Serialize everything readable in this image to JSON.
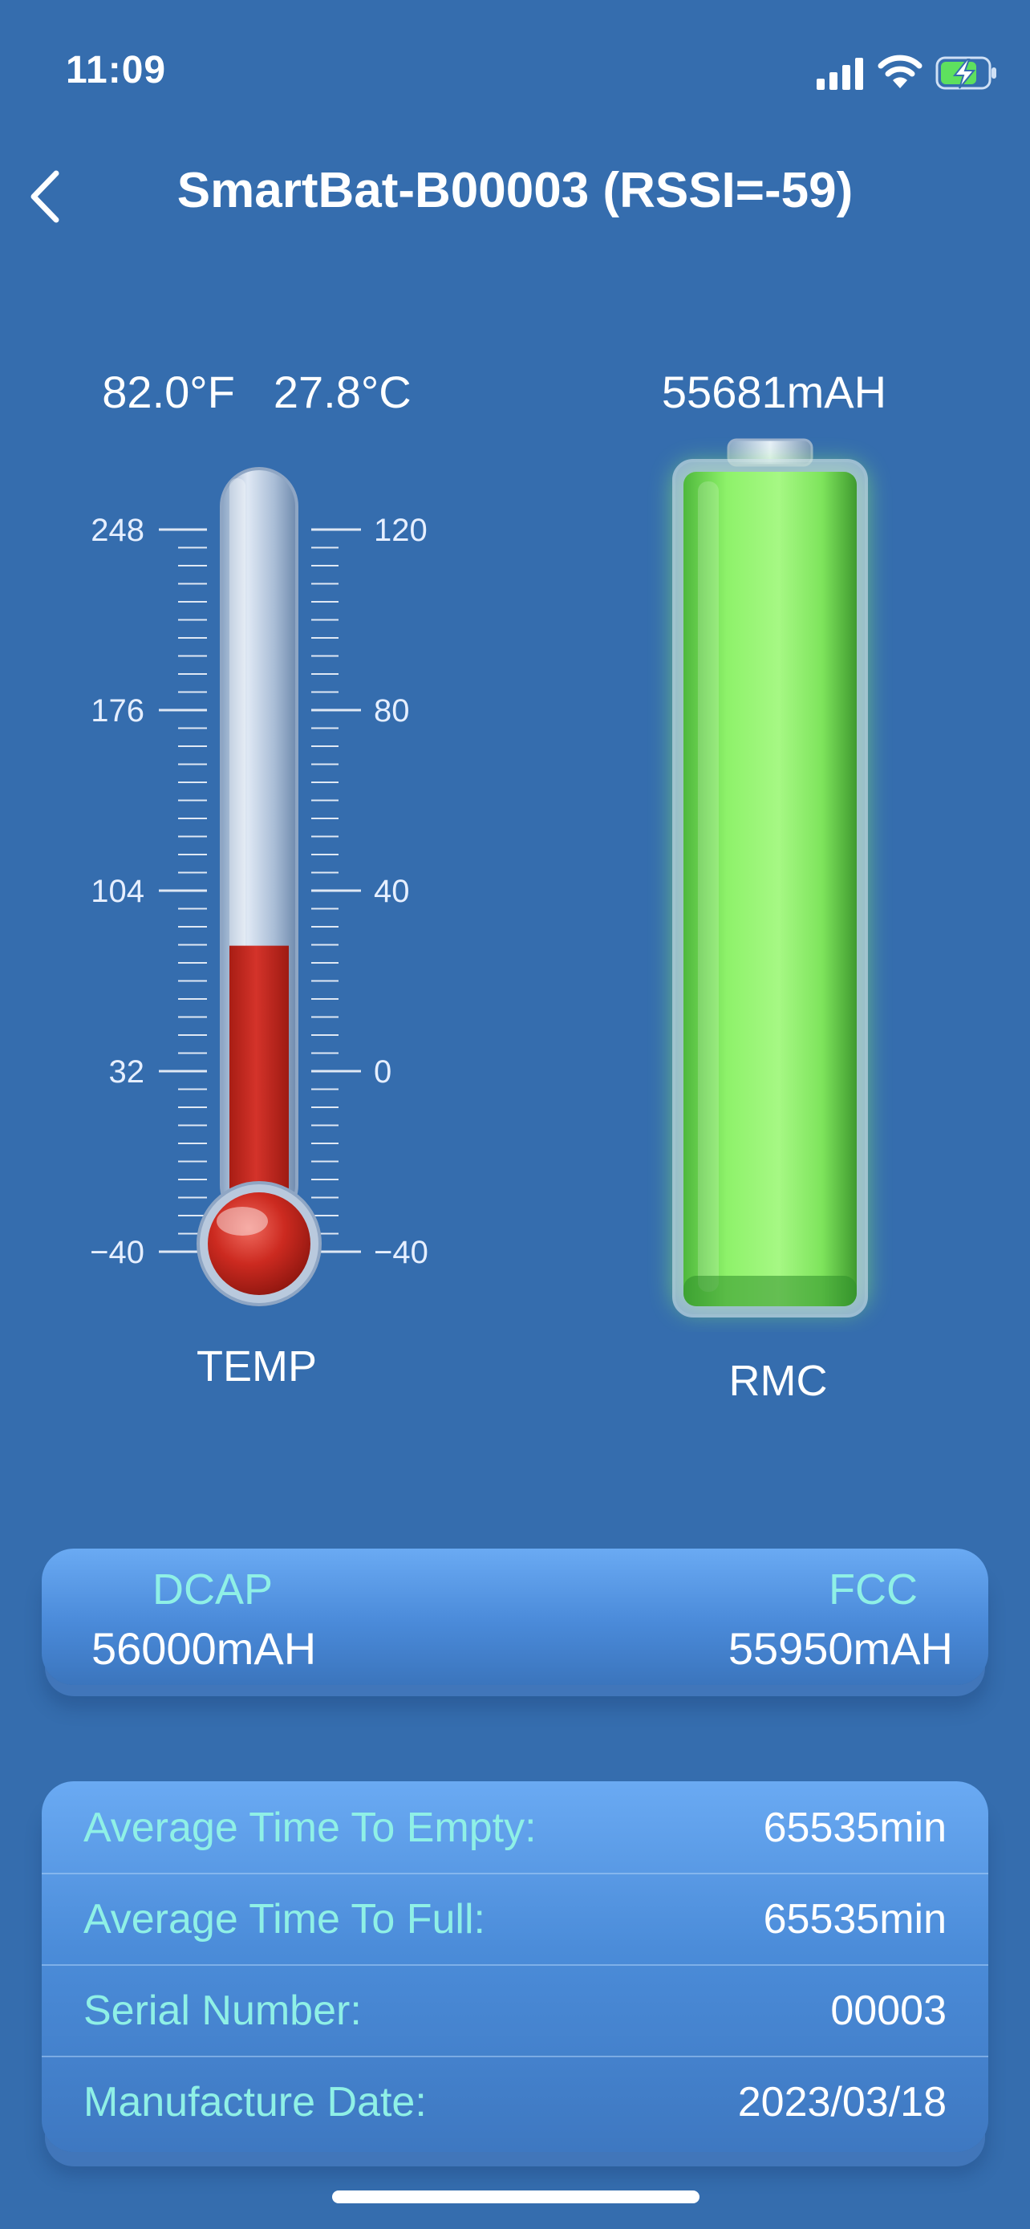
{
  "status_bar": {
    "time": "11:09",
    "icons": [
      "signal-bars-icon",
      "wifi-icon",
      "battery-charging-icon"
    ],
    "battery_icon_color": "#5ee05e"
  },
  "header": {
    "title": "SmartBat-B00003 (RSSI=-59)",
    "back_icon": "chevron-left-icon"
  },
  "temperature": {
    "fahrenheit": "82.0°F",
    "celsius": "27.8°C",
    "celsius_value": 27.8,
    "label": "TEMP",
    "left_scale": [
      "248",
      "176",
      "104",
      "32",
      "−40"
    ],
    "right_scale": [
      "120",
      "80",
      "40",
      "0",
      "−40"
    ],
    "scale_min_c": -40,
    "scale_max_c": 120,
    "mercury_color": "#c62a1f"
  },
  "battery": {
    "rmc": "55681mAH",
    "label": "RMC",
    "fill_fraction": 1.0,
    "fill_color": "#8ef26a"
  },
  "capacity": {
    "dcap_label": "DCAP",
    "dcap_value": "56000mAH",
    "fcc_label": "FCC",
    "fcc_value": "55950mAH"
  },
  "info": {
    "rows": [
      {
        "label": "Average Time To Empty:",
        "value": "65535min"
      },
      {
        "label": "Average Time To Full:",
        "value": "65535min"
      },
      {
        "label": "Serial Number:",
        "value": "00003"
      },
      {
        "label": "Manufacture Date:",
        "value": "2023/03/18"
      }
    ]
  },
  "colors": {
    "background": "#356dae",
    "label_accent": "#8ff0e6",
    "card": "#4b8cd9"
  }
}
